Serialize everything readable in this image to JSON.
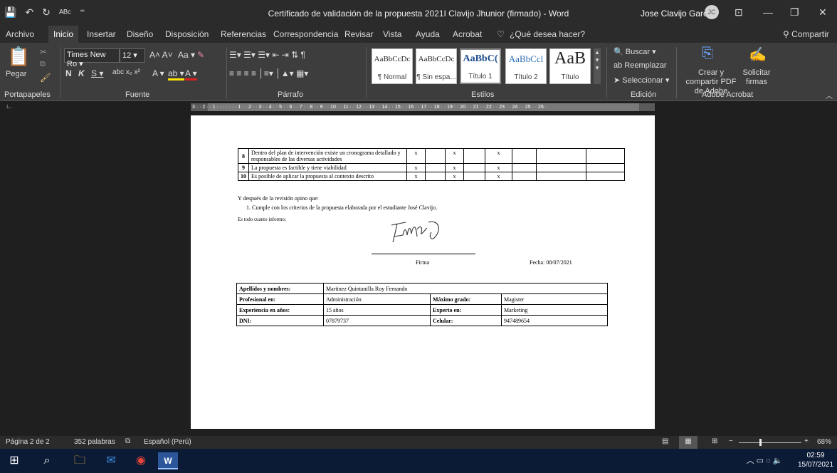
{
  "titlebar": {
    "title": "Certificado de validación de la propuesta 2021I Clavijo Jhunior (firmado)  -  Word",
    "user": "Jose Clavijo Garcia",
    "avatar": "JC"
  },
  "tabs": [
    "Archivo",
    "Inicio",
    "Insertar",
    "Diseño",
    "Disposición",
    "Referencias",
    "Correspondencia",
    "Revisar",
    "Vista",
    "Ayuda",
    "Acrobat"
  ],
  "tell_me": "¿Qué desea hacer?",
  "share": "Compartir",
  "ribbon": {
    "paste": "Pegar",
    "font_name": "Times New Ro",
    "font_size": "12",
    "groups": [
      "Portapapeles",
      "Fuente",
      "Párrafo",
      "Estilos",
      "Edición",
      "Adobe Acrobat"
    ],
    "styles": [
      {
        "sample": "AaBbCcDc",
        "name": "¶ Normal"
      },
      {
        "sample": "AaBbCcDc",
        "name": "¶ Sin espa..."
      },
      {
        "sample": "AaBbC(",
        "name": "Título 1"
      },
      {
        "sample": "AaBbCcl",
        "name": "Título 2"
      },
      {
        "sample": "AaB",
        "name": "Título"
      }
    ],
    "buscar": "Buscar",
    "reemplazar": "Reemplazar",
    "seleccionar": "Seleccionar",
    "adobe_create": "Crear y compartir PDF de Adobe",
    "adobe_sign": "Solicitar firmas"
  },
  "document": {
    "rows": [
      {
        "n": "8",
        "text": "Dentro del plan de intervención existe un cronograma detallado y responsables de las diversas actividades",
        "marks": [
          "x",
          "",
          "x",
          "",
          "x",
          "",
          "",
          ""
        ]
      },
      {
        "n": "9",
        "text": "La propuesta es factible y tiene viabilidad",
        "marks": [
          "x",
          "",
          "x",
          "",
          "x",
          "",
          "",
          ""
        ]
      },
      {
        "n": "10",
        "text": "Es posible de aplicar la propuesta al contexto descrito",
        "marks": [
          "x",
          "",
          "x",
          "",
          "x",
          "",
          "",
          ""
        ]
      }
    ],
    "opinion": "Y después de la revisión opino que:",
    "item1": "1.   Cumple con los criterios de la propuesta elaborada por el estudiante José Clavijo.",
    "closing": "Es todo cuanto informo;",
    "firma": "Firma",
    "fecha": "Fecha: 08/07/2021",
    "info": {
      "apellidos_label": "Apellidos y nombres:",
      "apellidos": "Martinez Quintanilla Roy Fernando",
      "profesional_label": "Profesional en:",
      "profesional": "Administración",
      "grado_label": "Máximo grado:",
      "grado": "Magister",
      "experiencia_label": "Experiencia en años:",
      "experiencia": "15 años",
      "experto_label": "Experto en:",
      "experto": "Marketing",
      "dni_label": "DNI:",
      "dni": "07879737",
      "celular_label": "Celular:",
      "celular": "947489654"
    }
  },
  "status": {
    "page": "Página 2 de 2",
    "words": "352 palabras",
    "lang": "Español (Perú)",
    "zoom": "68%"
  },
  "clock": {
    "time": "02:59",
    "date": "15/07/2021"
  }
}
